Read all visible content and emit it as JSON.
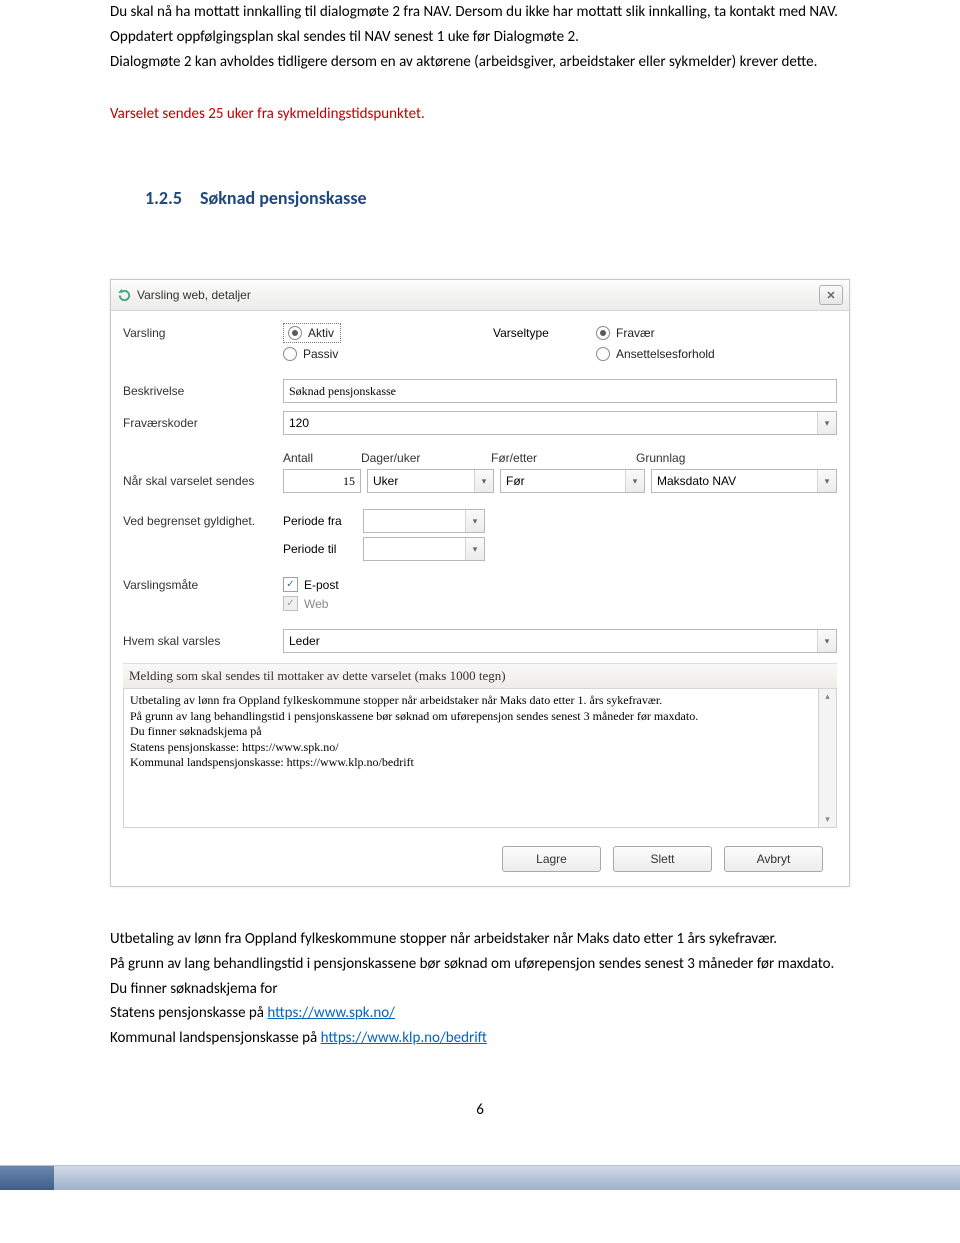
{
  "intro": {
    "p1": "Du skal nå ha mottatt innkalling til dialogmøte 2 fra NAV. Dersom du ikke har mottatt slik innkalling, ta kontakt med NAV.",
    "p2": "Oppdatert oppfølgingsplan skal sendes til NAV senest 1 uke før Dialogmøte 2.",
    "p3": "Dialogmøte 2 kan avholdes tidligere dersom en av aktørene (arbeidsgiver, arbeidstaker eller sykmelder) krever dette.",
    "red": "Varselet sendes 25 uker fra sykmeldingstidspunktet."
  },
  "section": {
    "num": "1.2.5",
    "title": "Søknad pensjonskasse"
  },
  "dialog": {
    "title": "Varsling web, detaljer",
    "close": "✕",
    "labels": {
      "varsling": "Varsling",
      "varseltype": "Varseltype",
      "beskrivelse": "Beskrivelse",
      "fravaerskoder": "Fraværskoder",
      "naar": "Når skal varselet sendes",
      "gyldighet": "Ved begrenset gyldighet.",
      "periode_fra": "Periode fra",
      "periode_til": "Periode til",
      "varslingsmate": "Varslingsmåte",
      "hvem": "Hvem skal varsles"
    },
    "radios": {
      "aktiv": "Aktiv",
      "passiv": "Passiv",
      "fravaer": "Fravær",
      "ansettelse": "Ansettelsesforhold"
    },
    "values": {
      "beskrivelse": "Søknad pensjonskasse",
      "fravaerskoder": "120",
      "antall": "15",
      "dager_uker": "Uker",
      "for_etter": "Før",
      "grunnlag": "Maksdato NAV",
      "periode_fra": "",
      "periode_til": "",
      "epost": "E-post",
      "web": "Web",
      "hvem": "Leder"
    },
    "cols": {
      "antall": "Antall",
      "dager_uker": "Dager/uker",
      "for_etter": "Før/etter",
      "grunnlag": "Grunnlag"
    },
    "msg_header": "Melding som skal sendes til mottaker av dette varselet (maks 1000 tegn)",
    "msg_body": "Utbetaling av lønn fra Oppland fylkeskommune stopper når arbeidstaker når Maks dato etter 1. års sykefravær.\nPå grunn av lang behandlingstid i pensjonskassene bør søknad om uførepensjon sendes senest 3 måneder før maxdato.\nDu finner søknadskjema på\nStatens pensjonskasse: https://www.spk.no/\nKommunal landspensjonskasse: https://www.klp.no/bedrift",
    "buttons": {
      "lagre": "Lagre",
      "slett": "Slett",
      "avbryt": "Avbryt"
    }
  },
  "after": {
    "p1": "Utbetaling av lønn fra Oppland fylkeskommune stopper når arbeidstaker når Maks dato etter 1 års sykefravær.",
    "p2": "På grunn av lang behandlingstid i pensjonskassene bør søknad om uførepensjon sendes senest 3 måneder før maxdato. Du finner søknadskjema for",
    "spk_pre": "Statens pensjonskasse på ",
    "spk_link": "https://www.spk.no/",
    "klp_pre": "Kommunal landspensjonskasse på ",
    "klp_link": "https://www.klp.no/bedrift"
  },
  "pagenum": "6"
}
